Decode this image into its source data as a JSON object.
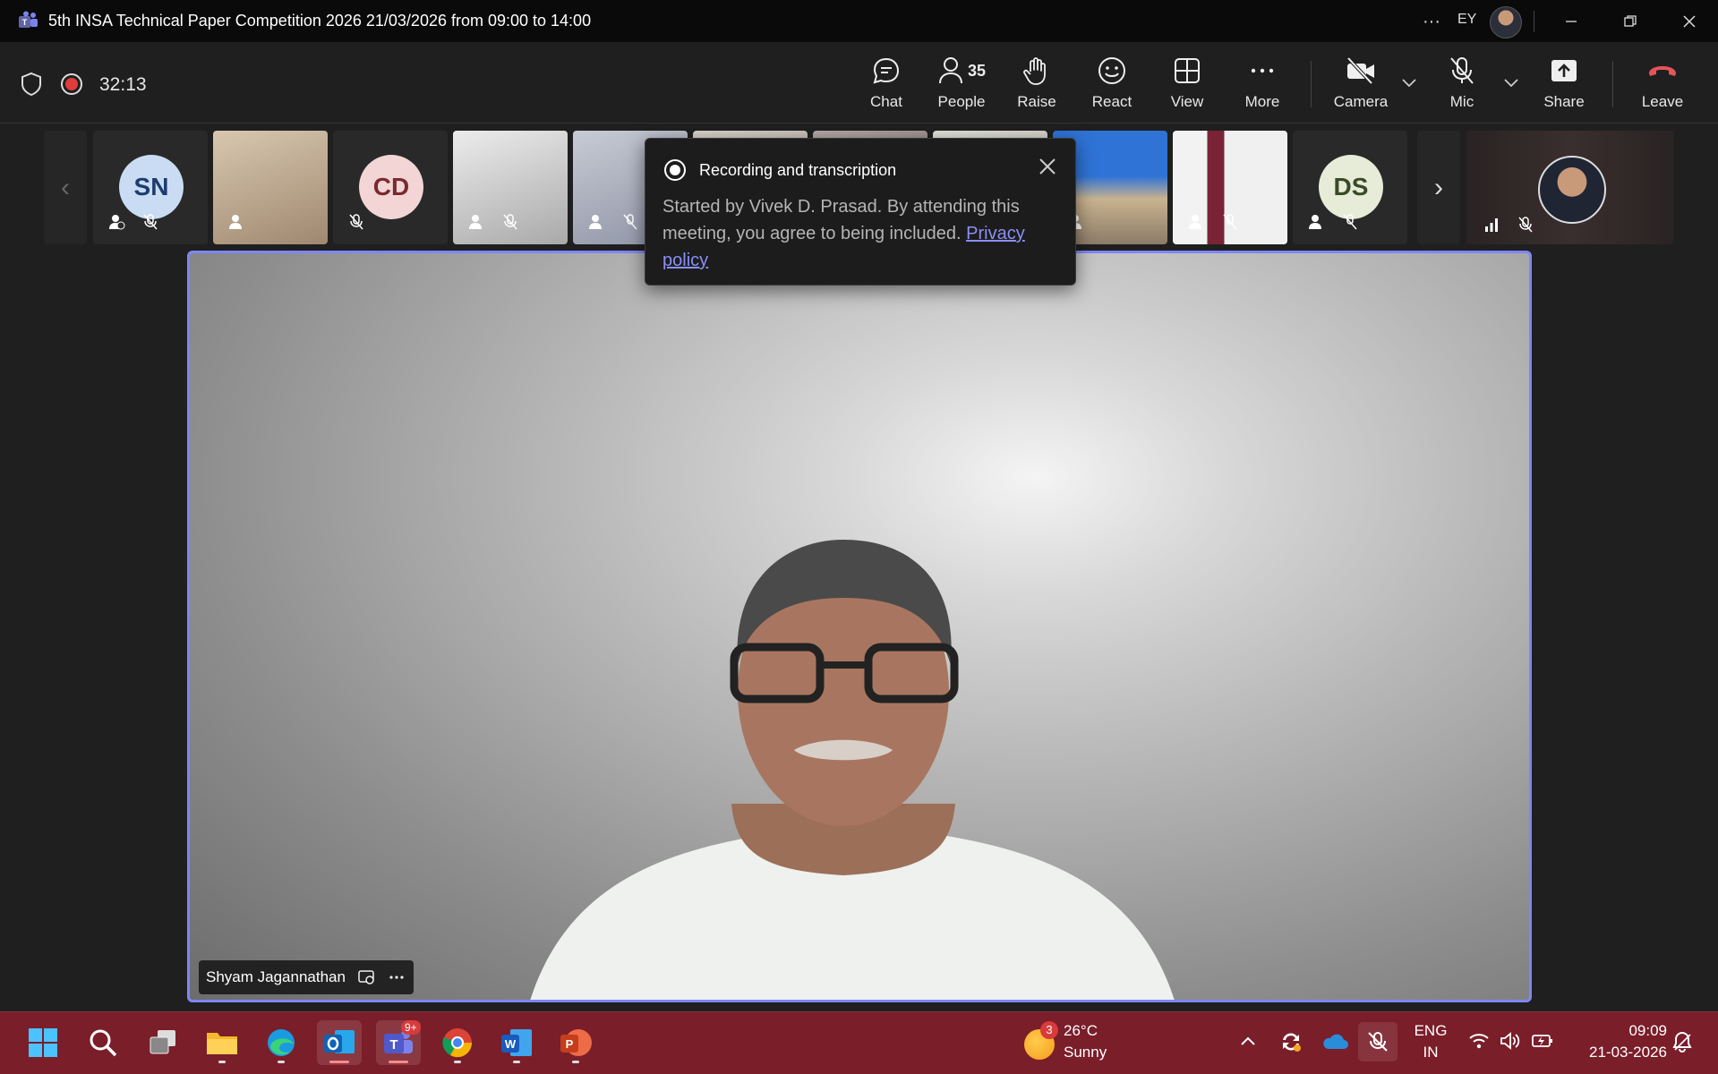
{
  "window": {
    "title": "5th INSA Technical Paper Competition 2026 21/03/2026 from 09:00 to 14:00",
    "user_initials": "EY"
  },
  "meeting": {
    "elapsed": "32:13"
  },
  "toolbar": {
    "chat": "Chat",
    "people": "People",
    "people_count": "35",
    "raise": "Raise",
    "react": "React",
    "view": "View",
    "more": "More",
    "camera": "Camera",
    "mic": "Mic",
    "share": "Share",
    "leave": "Leave"
  },
  "participants": [
    {
      "initials": "SN",
      "type": "avatar",
      "color": "#c9dcf3",
      "text_color": "#1e3c6e"
    },
    {
      "type": "video"
    },
    {
      "initials": "CD",
      "type": "avatar",
      "color": "#f3d5d6",
      "text_color": "#7a2a30"
    },
    {
      "type": "video"
    },
    {
      "type": "video"
    },
    {
      "type": "video"
    },
    {
      "type": "video"
    },
    {
      "type": "video"
    },
    {
      "type": "video"
    },
    {
      "type": "video"
    },
    {
      "initials": "DS",
      "type": "avatar",
      "color": "#e6ecd8",
      "text_color": "#3b4a26"
    }
  ],
  "popup": {
    "title": "Recording and transcription",
    "body": "Started by Vivek D. Prasad. By attending this meeting, you agree to being included.",
    "link": "Privacy policy"
  },
  "stage": {
    "speaker_name": "Shyam Jagannathan"
  },
  "taskbar": {
    "teams_badge": "9+",
    "weather_badge": "3",
    "temperature": "26°C",
    "weather": "Sunny",
    "lang_line1": "ENG",
    "lang_line2": "IN",
    "time": "09:09",
    "date": "21-03-2026"
  },
  "colors": {
    "accent": "#7f85f5",
    "leave": "#e5545c",
    "taskbar": "#7a1e2a",
    "recording": "#e03c3c"
  }
}
